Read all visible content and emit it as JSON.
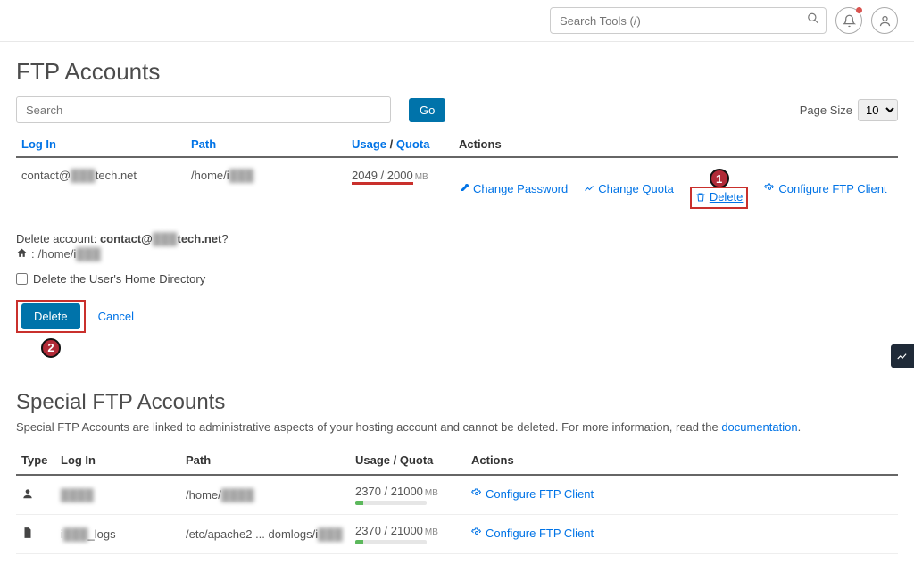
{
  "topbar": {
    "search_placeholder": "Search Tools (/)"
  },
  "page_title": "FTP Accounts",
  "filter": {
    "search_placeholder": "Search",
    "go_label": "Go",
    "page_size_label": "Page Size",
    "page_size_value": "10"
  },
  "table": {
    "headers": {
      "login": "Log In",
      "path": "Path",
      "usage": "Usage",
      "quota": "Quota",
      "actions": "Actions"
    },
    "row": {
      "login_prefix": "contact@",
      "login_blur": "███",
      "login_suffix": "tech.net",
      "path_prefix": "/home/i",
      "path_blur": "███",
      "usage": "2049 / 2000",
      "usage_unit": "MB",
      "action_change_password": "Change Password",
      "action_change_quota": "Change Quota",
      "action_delete": "Delete",
      "action_configure": "Configure FTP Client"
    }
  },
  "callouts": {
    "one": "1",
    "two": "2"
  },
  "confirm": {
    "prefix": "Delete account: ",
    "account_bold_pre": "contact@",
    "account_blur": "███",
    "account_bold_post": "tech.net",
    "question_mark": "?",
    "home_prefix": " /home/i",
    "home_blur": "███",
    "checkbox_label": "Delete the User's Home Directory",
    "delete_btn": "Delete",
    "cancel": "Cancel"
  },
  "special": {
    "title": "Special FTP Accounts",
    "desc_pre": "Special FTP Accounts are linked to administrative aspects of your hosting account and cannot be deleted. For more information, read the ",
    "desc_link": "documentation",
    "desc_post": ".",
    "headers": {
      "type": "Type",
      "login": "Log In",
      "path": "Path",
      "usage": "Usage / Quota",
      "actions": "Actions"
    },
    "rows": [
      {
        "icon": "user",
        "login_blur": "████",
        "path_pre": "/home/",
        "path_blur": "████",
        "usage": "2370 / 21000",
        "usage_unit": "MB",
        "bar_pct": 11,
        "action": "Configure FTP Client"
      },
      {
        "icon": "file",
        "login_pre": "i",
        "login_blur": "███",
        "login_post": "_logs",
        "path_pre": "/etc/apache2 ",
        "path_dots": "...",
        "path_mid": " domlogs/i",
        "path_blur": "███",
        "usage": "2370 / 21000",
        "usage_unit": "MB",
        "bar_pct": 11,
        "action": "Configure FTP Client"
      }
    ]
  }
}
